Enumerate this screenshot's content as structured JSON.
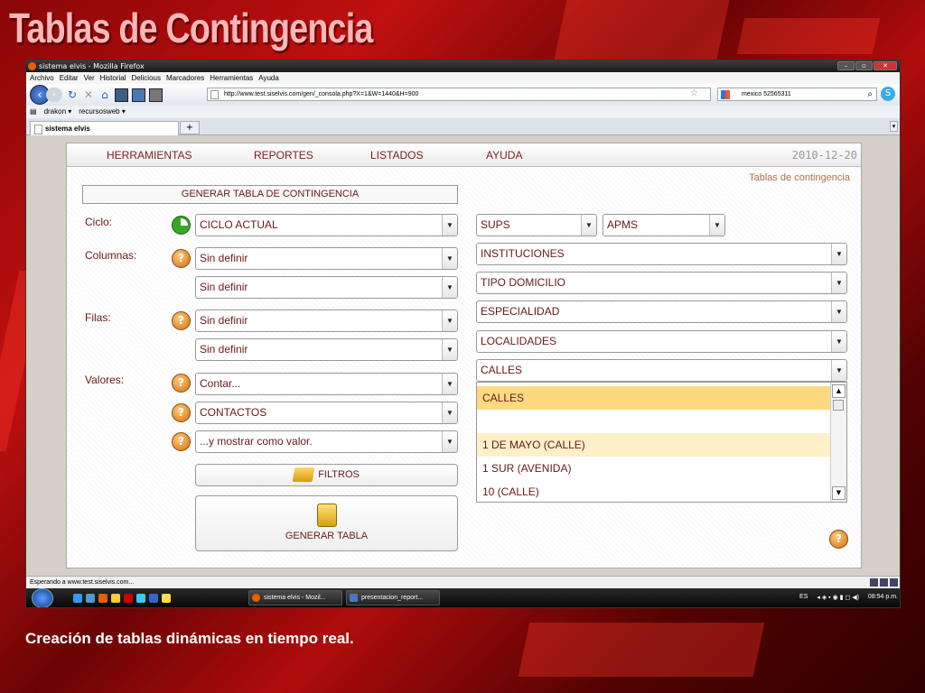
{
  "slide": {
    "title": "Tablas de Contingencia",
    "caption": "Creación de tablas dinámicas en tiempo real."
  },
  "browser": {
    "window_title": "sistema elvis - Mozilla Firefox",
    "menu": [
      "Archivo",
      "Editar",
      "Ver",
      "Historial",
      "Delicious",
      "Marcadores",
      "Herramientas",
      "Ayuda"
    ],
    "url": "http://www.test.siselvis.com/gen/_consola.php?X=1&W=1440&H=900",
    "search_value": "mexico 52565311",
    "bookmarks": [
      "drakon ▾",
      "recursosweb ▾"
    ],
    "tab_label": "sistema elvis",
    "new_tab_symbol": "+",
    "status": "Esperando a www.test.siselvis.com..."
  },
  "app": {
    "menu": [
      "HERRAMIENTAS",
      "REPORTES",
      "LISTADOS",
      "AYUDA"
    ],
    "date": "2010-12-20",
    "page_subtitle": "Tablas de contingencia",
    "generate_header": "GENERAR TABLA DE CONTINGENCIA",
    "labels": {
      "ciclo": "Ciclo:",
      "columnas": "Columnas:",
      "filas": "Filas:",
      "valores": "Valores:"
    },
    "help_symbol": "?",
    "ciclo_select": "CICLO ACTUAL",
    "columnas_selects": [
      "Sin definir",
      "Sin definir"
    ],
    "filas_selects": [
      "Sin definir",
      "Sin definir"
    ],
    "valores_selects": [
      "Contar...",
      "CONTACTOS",
      "...y mostrar como valor."
    ],
    "right_selects": {
      "sups": "SUPS",
      "apms": "APMS",
      "instituciones": "INSTITUCIONES",
      "tipo_domicilio": "TIPO DOMICILIO",
      "especialidad": "ESPECIALIDAD",
      "localidades": "LOCALIDADES",
      "calles": "CALLES"
    },
    "calles_options": [
      "CALLES",
      "",
      "1 DE MAYO (CALLE)",
      "1 SUR (AVENIDA)",
      "10 (CALLE)"
    ],
    "filtros_button": "FILTROS",
    "generar_button": "GENERAR TABLA",
    "arrow_symbol": "▼"
  },
  "taskbar": {
    "tasks": [
      "sistema elvis - Mozil...",
      "presentacion_report..."
    ],
    "lang": "ES",
    "time": "08:54 p.m."
  },
  "colors": {
    "accent": "#6a1818",
    "highlight": "#ffd980",
    "slide_bg": "#b00c0c"
  }
}
